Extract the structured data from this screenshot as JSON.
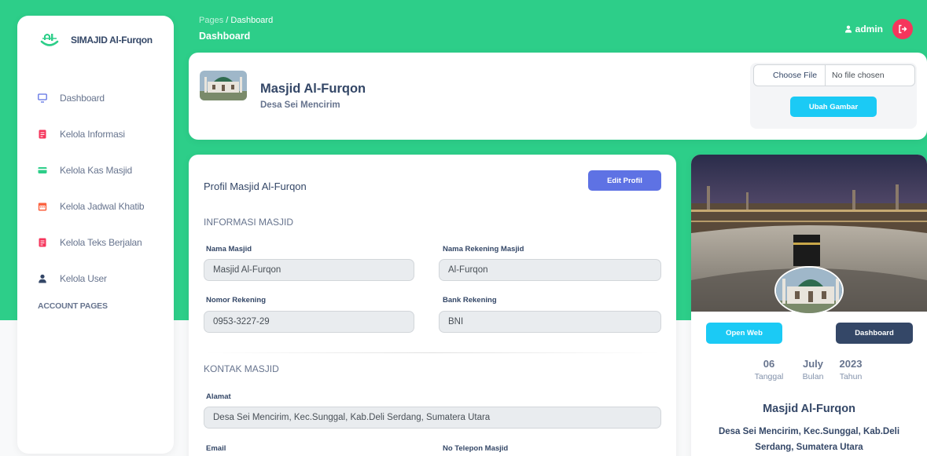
{
  "app": {
    "brand": "SIMAJID Al-Furqon"
  },
  "sidebar": {
    "items": [
      {
        "label": "Dashboard",
        "icon": "monitor-icon",
        "color": "#5e72e4"
      },
      {
        "label": "Kelola Informasi",
        "icon": "document-icon",
        "color": "#f5365c"
      },
      {
        "label": "Kelola Kas Masjid",
        "icon": "credit-card-icon",
        "color": "#2dce89"
      },
      {
        "label": "Kelola Jadwal Khatib",
        "icon": "calendar-icon",
        "color": "#fb6340"
      },
      {
        "label": "Kelola Teks Berjalan",
        "icon": "document-icon",
        "color": "#f5365c"
      },
      {
        "label": "Kelola User",
        "icon": "user-icon",
        "color": "#344767"
      }
    ],
    "section_label": "ACCOUNT PAGES"
  },
  "topbar": {
    "breadcrumb_root": "Pages",
    "breadcrumb_sep": "/",
    "breadcrumb_current": "Dashboard",
    "title": "Dashboard",
    "user": "admin"
  },
  "header": {
    "name": "Masjid Al-Furqon",
    "subtitle": "Desa Sei Mencirim",
    "file_button": "Choose File",
    "file_status": "No file chosen",
    "change_image_button": "Ubah Gambar"
  },
  "profile": {
    "title": "Profil Masjid Al-Furqon",
    "edit_button": "Edit Profil",
    "info_section": "INFORMASI MASJID",
    "contact_section": "KONTAK MASJID",
    "fields": {
      "nama_masjid": {
        "label": "Nama Masjid",
        "value": "Masjid Al-Furqon"
      },
      "nama_rekening": {
        "label": "Nama Rekening Masjid",
        "value": "Al-Furqon"
      },
      "nomor_rekening": {
        "label": "Nomor Rekening",
        "value": "0953-3227-29"
      },
      "bank_rekening": {
        "label": "Bank Rekening",
        "value": "BNI"
      },
      "alamat": {
        "label": "Alamat",
        "value": "Desa Sei Mencirim, Kec.Sunggal, Kab.Deli Serdang, Sumatera Utara"
      },
      "email": {
        "label": "Email"
      },
      "telepon": {
        "label": "No Telepon Masjid"
      }
    }
  },
  "side": {
    "open_web_button": "Open Web",
    "dashboard_button": "Dashboard",
    "day": "06",
    "day_label": "Tanggal",
    "month": "July",
    "month_label": "Bulan",
    "year": "2023",
    "year_label": "Tahun",
    "name": "Masjid Al-Furqon",
    "address": "Desa Sei Mencirim, Kec.Sunggal, Kab.Deli Serdang, Sumatera Utara"
  },
  "colors": {
    "primary_green": "#2dce89",
    "info": "#1bcaf5",
    "indigo": "#5e72e4",
    "dark": "#344767",
    "danger": "#f5365c"
  }
}
